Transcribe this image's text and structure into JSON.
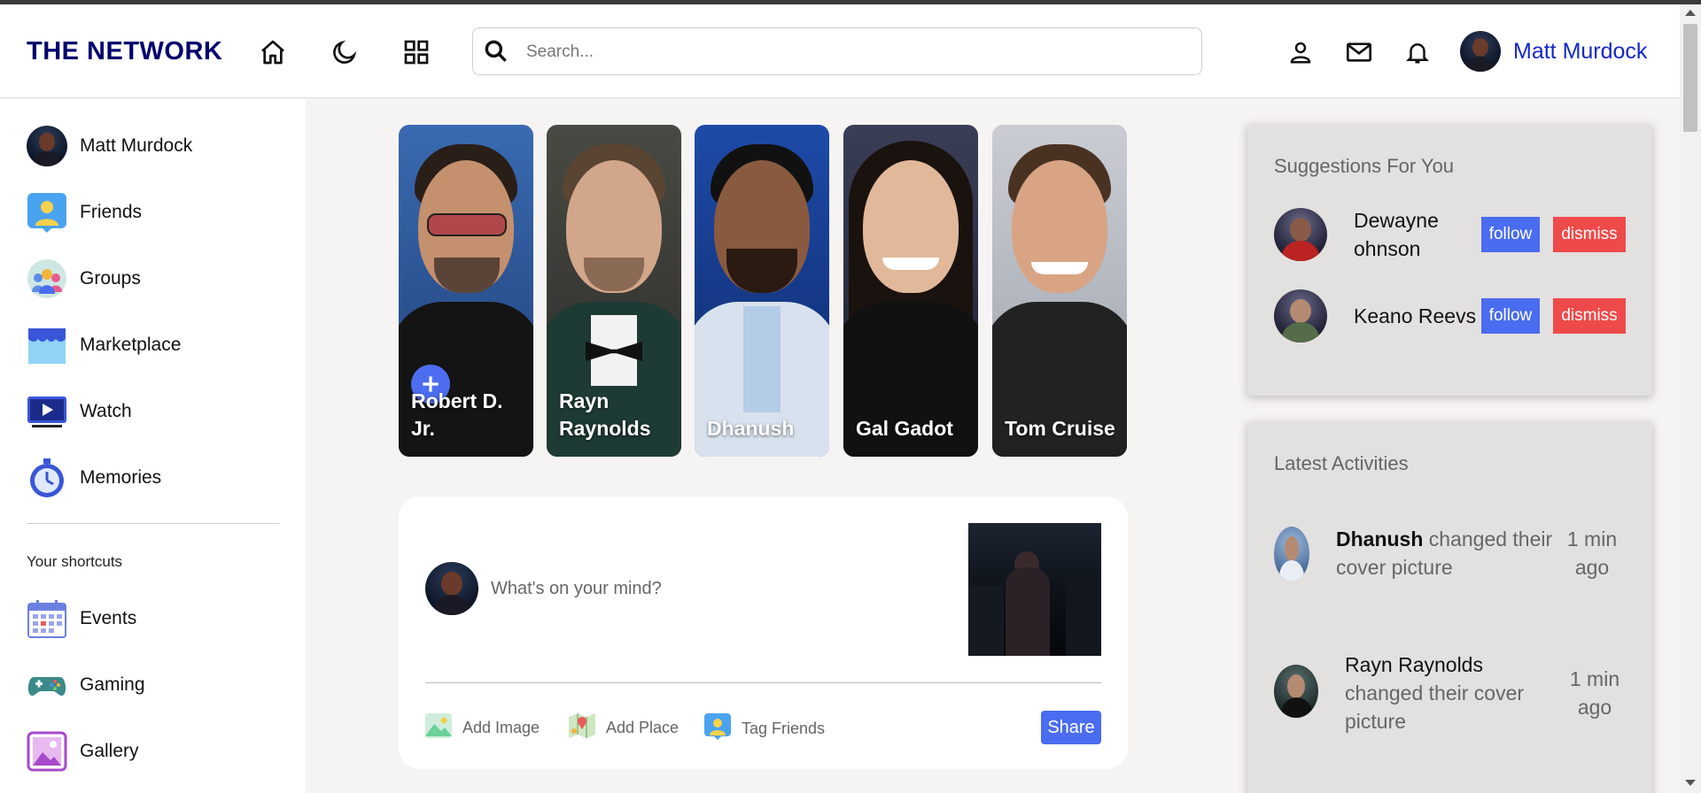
{
  "app": {
    "logo": "THE NETWORK",
    "user_name": "Matt Murdock"
  },
  "nav": {
    "icons": [
      "home-icon",
      "moon-icon",
      "grid-icon"
    ],
    "right_icons": [
      "person-icon",
      "mail-icon",
      "bell-icon"
    ]
  },
  "search": {
    "placeholder": "Search...",
    "value": ""
  },
  "sidebar": {
    "items": [
      {
        "label": "Matt Murdock",
        "icon": "avatar"
      },
      {
        "label": "Friends",
        "icon": "friends-icon"
      },
      {
        "label": "Groups",
        "icon": "groups-icon"
      },
      {
        "label": "Marketplace",
        "icon": "marketplace-icon"
      },
      {
        "label": "Watch",
        "icon": "watch-icon"
      },
      {
        "label": "Memories",
        "icon": "memories-icon"
      }
    ],
    "shortcuts_title": "Your shortcuts",
    "shortcuts": [
      {
        "label": "Events",
        "icon": "events-icon"
      },
      {
        "label": "Gaming",
        "icon": "gaming-icon"
      },
      {
        "label": "Gallery",
        "icon": "gallery-icon"
      }
    ]
  },
  "stories": [
    {
      "name": "Robert D. Jr."
    },
    {
      "name": "Rayn Raynolds"
    },
    {
      "name": "Dhanush"
    },
    {
      "name": "Gal Gadot"
    },
    {
      "name": "Tom Cruise"
    }
  ],
  "share": {
    "placeholder": "What's on your mind?",
    "options": [
      "Add Image",
      "Add Place",
      "Tag Friends"
    ],
    "button": "Share"
  },
  "suggestions": {
    "title": "Suggestions For You",
    "people": [
      {
        "name": "Dewayne ohnson",
        "follow": "follow",
        "dismiss": "dismiss"
      },
      {
        "name": "Keano Reevs",
        "follow": "follow",
        "dismiss": "dismiss"
      }
    ]
  },
  "activities": {
    "title": "Latest Activities",
    "items": [
      {
        "name": "Dhanush",
        "text": "changed their cover picture",
        "time": "1 min ago"
      },
      {
        "name": "Rayn Raynolds",
        "text": "changed their cover picture",
        "time": "1 min ago"
      }
    ]
  },
  "colors": {
    "logo": "#00006e",
    "accent": "#4a6cf0",
    "danger": "#ef4a4a",
    "username": "#1428c8"
  }
}
